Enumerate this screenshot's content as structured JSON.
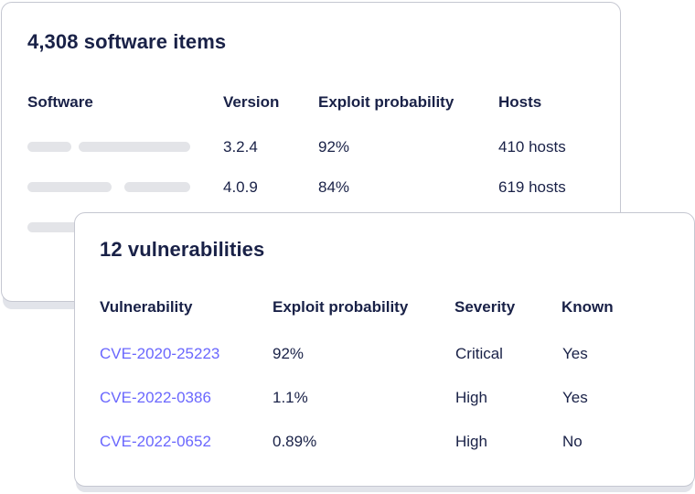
{
  "software_card": {
    "title": "4,308 software items",
    "columns": [
      "Software",
      "Version",
      "Exploit probability",
      "Hosts"
    ],
    "rows": [
      {
        "version": "3.2.4",
        "exploit_probability": "92%",
        "hosts": "410 hosts"
      },
      {
        "version": "4.0.9",
        "exploit_probability": "84%",
        "hosts": "619 hosts"
      }
    ]
  },
  "vulnerabilities_card": {
    "title": "12 vulnerabilities",
    "columns": [
      "Vulnerability",
      "Exploit probability",
      "Severity",
      "Known"
    ],
    "rows": [
      {
        "cve": "CVE-2020-25223",
        "exploit_probability": "92%",
        "severity": "Critical",
        "known": "Yes"
      },
      {
        "cve": "CVE-2022-0386",
        "exploit_probability": "1.1%",
        "severity": "High",
        "known": "Yes"
      },
      {
        "cve": "CVE-2022-0652",
        "exploit_probability": "0.89%",
        "severity": "High",
        "known": "No"
      }
    ]
  },
  "colors": {
    "heading": "#192147",
    "link": "#6a67fe",
    "skeleton": "#e3e4e8",
    "border": "#c5c7d1"
  }
}
